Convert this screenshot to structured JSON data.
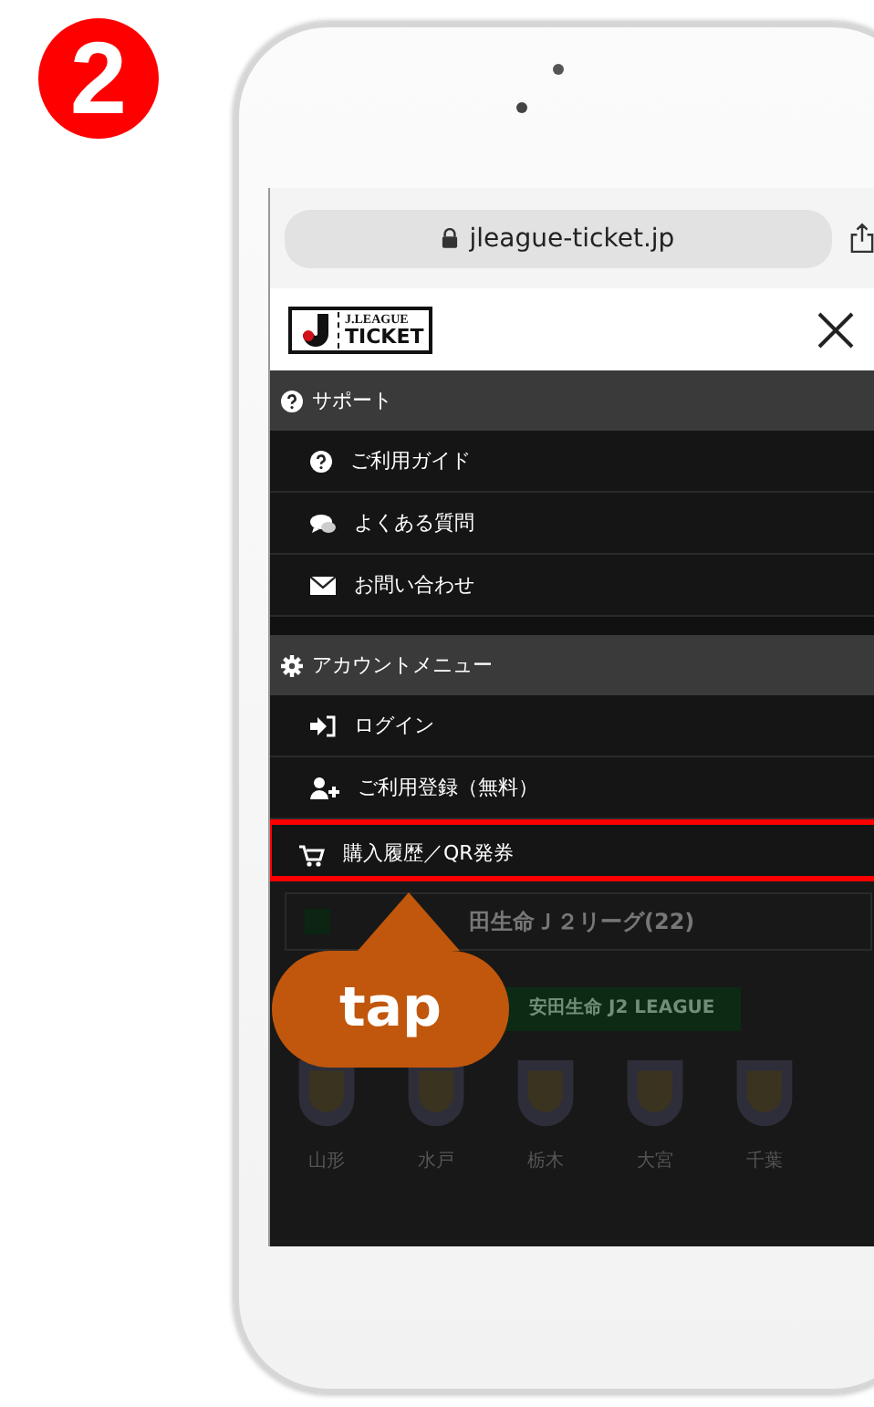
{
  "step_badge": "2",
  "browser": {
    "url": "jleague-ticket.jp"
  },
  "header": {
    "logo_top": "J.LEAGUE",
    "logo_bottom": "TICKET"
  },
  "menu": [
    {
      "kind": "section",
      "label": "サポート",
      "highlighted": false
    },
    {
      "kind": "item",
      "label": "ご利用ガイド",
      "highlighted": false
    },
    {
      "kind": "item",
      "label": "よくある質問",
      "highlighted": false
    },
    {
      "kind": "item",
      "label": "お問い合わせ",
      "highlighted": false
    },
    {
      "kind": "section",
      "label": "アカウントメニュー",
      "highlighted": false
    },
    {
      "kind": "item",
      "label": "ログイン",
      "highlighted": false
    },
    {
      "kind": "item",
      "label": "ご利用登録（無料）",
      "highlighted": false
    },
    {
      "kind": "item",
      "label": "購入履歴／QR発券",
      "highlighted": true
    }
  ],
  "background": {
    "league_row": "田生命Ｊ２リーグ(22)",
    "banner": "安田生命 J2 LEAGUE",
    "clubs": [
      "山形",
      "水戸",
      "栃木",
      "大宮",
      "千葉"
    ]
  },
  "callout": {
    "label": "tap"
  }
}
